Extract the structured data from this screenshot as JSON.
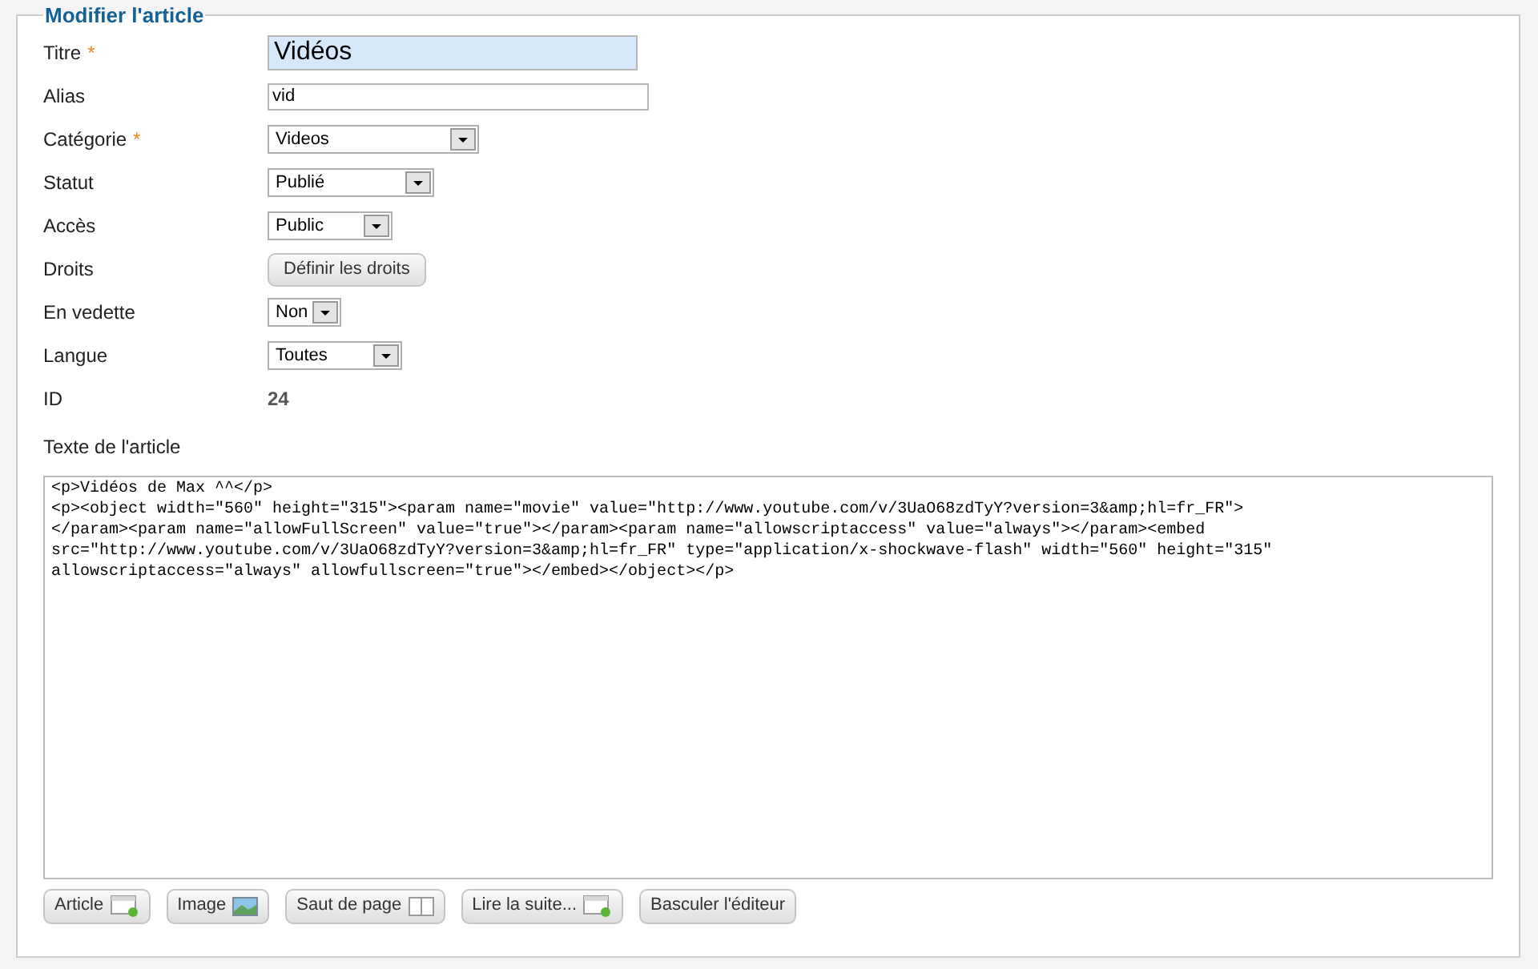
{
  "legend": "Modifier l'article",
  "fields": [
    {
      "label": "Titre",
      "required_mark": "*",
      "kind": "title",
      "value": "Vidéos"
    },
    {
      "label": "Alias",
      "kind": "text",
      "value": "vid"
    },
    {
      "label": "Catégorie",
      "required_mark": "*",
      "kind": "select",
      "value": "Videos"
    },
    {
      "label": "Statut",
      "kind": "select",
      "value": "Publié"
    },
    {
      "label": "Accès",
      "kind": "select",
      "value": "Public"
    },
    {
      "label": "Droits",
      "kind": "button",
      "value": "Définir les droits"
    },
    {
      "label": "En vedette",
      "kind": "select",
      "value": "Non"
    },
    {
      "label": "Langue",
      "kind": "select",
      "value": "Toutes"
    },
    {
      "label": "ID",
      "kind": "static",
      "value": "24"
    }
  ],
  "editor_label": "Texte de l'article",
  "editor_lines": [
    "<p>Vidéos de Max ^^</p>",
    "<p><object width=\"560\" height=\"315\"><param name=\"movie\" value=\"http://www.youtube.com/v/3UaO68zdTyY?version=3&amp;hl=fr_FR\">",
    "</param><param name=\"allowFullScreen\" value=\"true\"></param><param name=\"allowscriptaccess\" value=\"always\"></param><embed",
    "src=\"http://www.youtube.com/v/3UaO68zdTyY?version=3&amp;hl=fr_FR\" type=\"application/x-shockwave-flash\" width=\"560\" height=\"315\"",
    "allowscriptaccess=\"always\" allowfullscreen=\"true\"></embed></object></p>"
  ],
  "buttons": [
    {
      "label": "Article"
    },
    {
      "label": "Image"
    },
    {
      "label": "Saut de page"
    },
    {
      "label": "Lire la suite..."
    },
    {
      "label": "Basculer l'éditeur"
    }
  ]
}
